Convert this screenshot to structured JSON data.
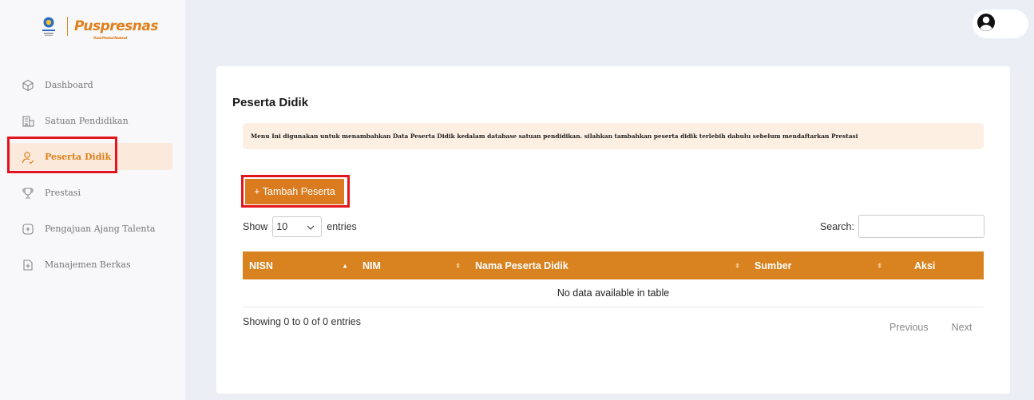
{
  "brand": {
    "name": "Puspresnas",
    "subtitle": "Pusat Prestasi Nasional",
    "accent": "#e07f1a"
  },
  "sidebar": {
    "items": [
      {
        "label": "Dashboard",
        "icon": "cube-icon"
      },
      {
        "label": "Satuan Pendidikan",
        "icon": "building-icon"
      },
      {
        "label": "Peserta Didik",
        "icon": "user-icon",
        "active": true
      },
      {
        "label": "Prestasi",
        "icon": "trophy-icon"
      },
      {
        "label": "Pengajuan Ajang Talenta",
        "icon": "plus-clipboard-icon"
      },
      {
        "label": "Manajemen Berkas",
        "icon": "plus-file-icon"
      }
    ]
  },
  "header": {
    "avatar_icon": "user-circle-icon"
  },
  "main": {
    "title": "Peserta Didik",
    "notice": "Menu Ini digunakan untuk menambahkan Data Peserta Didik kedalam database satuan pendidikan. silahkan tambahkan peserta didik terlebih dahulu sebelum mendaftarkan Prestasi",
    "add_button": "+ Tambah Peserta",
    "show_label": "Show",
    "entries_value": "10",
    "entries_label": "entries",
    "search_label": "Search:",
    "search_value": "",
    "table": {
      "columns": [
        "NISN",
        "NIM",
        "Nama Peserta Didik",
        "Sumber",
        "Aksi"
      ],
      "empty_text": "No data available in table"
    },
    "info": "Showing 0 to 0 of 0 entries",
    "pager": {
      "previous": "Previous",
      "next": "Next"
    }
  },
  "colors": {
    "header_row": "#d88220",
    "button": "#d97b1e",
    "notice_bg": "#fdefe1",
    "highlight": "#e3141b"
  }
}
